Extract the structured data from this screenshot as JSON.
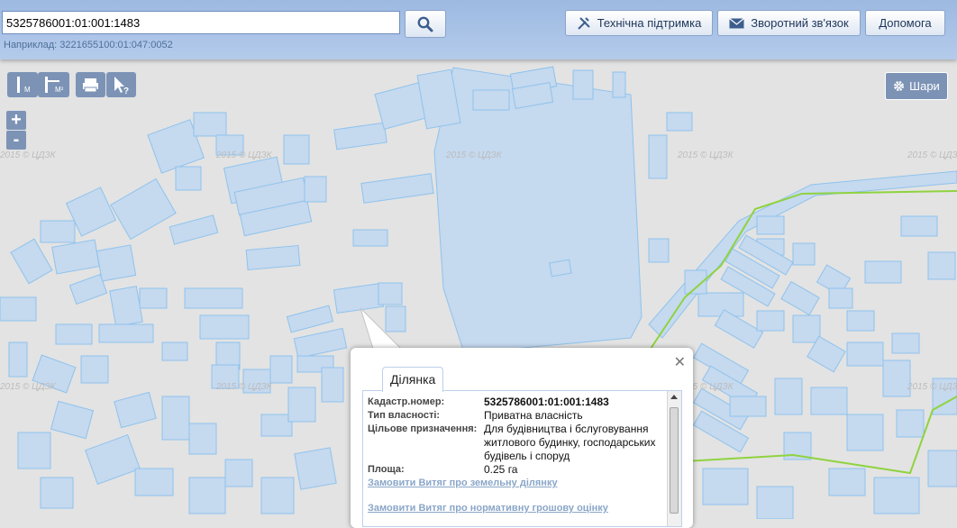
{
  "search": {
    "value": "5325786001:01:001:1483",
    "example": "Наприклад: 3221655100:01:047:0052"
  },
  "header_buttons": {
    "support": "Технічна підтримка",
    "feedback": "Зворотний зв'язок",
    "help": "Допомога"
  },
  "map_controls": {
    "measure_length_icon": "ruler-m-icon",
    "measure_area_icon": "ruler-m2-icon",
    "print_icon": "printer-icon",
    "identify_icon": "cursor-question-icon",
    "zoom_in": "+",
    "zoom_out": "-",
    "layers": "Шари"
  },
  "watermark": "2015 © ЦДЗК",
  "popup": {
    "tab": "Ділянка",
    "rows": [
      {
        "label": "Кадастр.номер:",
        "value": "5325786001:01:001:1483"
      },
      {
        "label": "Тип власності:",
        "value": "Приватна власність"
      },
      {
        "label": "Цільове призначення:",
        "value": "Для будівництва і бслуговування житлового будинку, господарських будівель і споруд"
      },
      {
        "label": "Площа:",
        "value": "0.25 га"
      }
    ],
    "links": [
      "Замовити Витяг про земельну ділянку",
      "Замовити Витяг про нормативну грошову оцінку"
    ]
  },
  "colors": {
    "parcel_fill": "#c5d9ef",
    "parcel_stroke": "#8fc3ec",
    "boundary_line": "#8fd33f",
    "map_bg": "#e3e3e3"
  }
}
